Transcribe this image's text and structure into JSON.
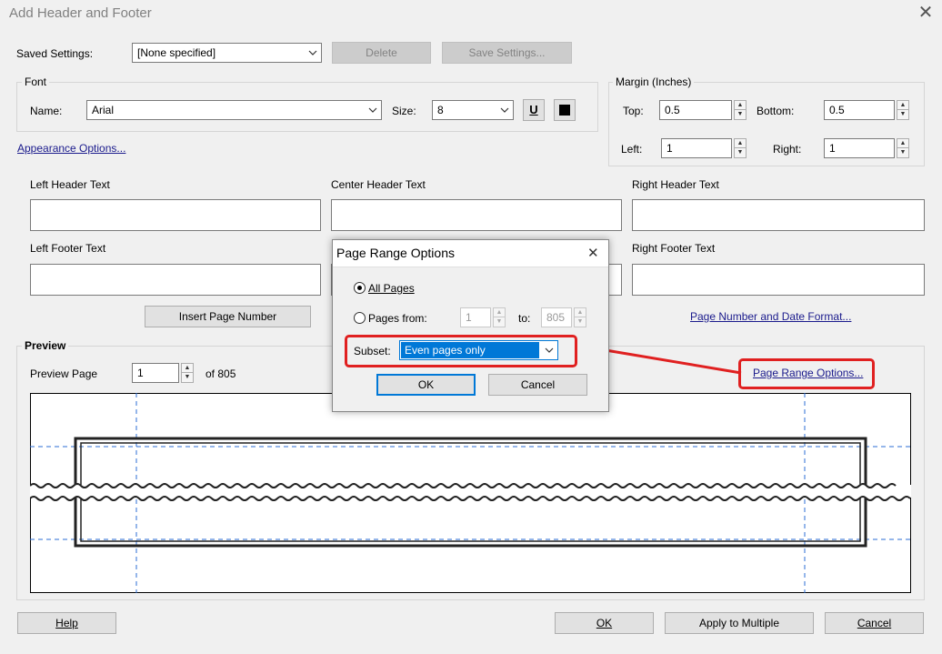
{
  "window": {
    "title": "Add Header and Footer",
    "close_glyph": "✕"
  },
  "saved_settings": {
    "label": "Saved Settings:",
    "value": "[None specified]",
    "delete_label": "Delete",
    "save_label": "Save Settings..."
  },
  "font": {
    "group_label": "Font",
    "name_label": "Name:",
    "name_value": "Arial",
    "size_label": "Size:",
    "size_value": "8",
    "underline_label": "U"
  },
  "margin": {
    "group_label": "Margin (Inches)",
    "top_label": "Top:",
    "top_value": "0.5",
    "bottom_label": "Bottom:",
    "bottom_value": "0.5",
    "left_label": "Left:",
    "left_value": "1",
    "right_label": "Right:",
    "right_value": "1"
  },
  "appearance_link": "Appearance Options...",
  "fields": {
    "left_header": "Left Header Text",
    "center_header": "Center Header Text",
    "right_header": "Right Header Text",
    "left_footer": "Left Footer Text",
    "right_footer": "Right Footer Text"
  },
  "insert_page_number": "Insert Page Number",
  "page_number_date_link": "Page Number and Date Format...",
  "preview": {
    "label": "Preview",
    "page_label": "Preview Page",
    "page_value": "1",
    "of_total": "of 805",
    "page_range_link": "Page Range Options..."
  },
  "footer_buttons": {
    "help": "Help",
    "ok": "OK",
    "apply_multiple": "Apply to Multiple",
    "cancel": "Cancel"
  },
  "dialog": {
    "title": "Page Range Options",
    "close_glyph": "✕",
    "all_pages": "All Pages",
    "pages_from": "Pages from:",
    "from_value": "1",
    "to_label": "to:",
    "to_value": "805",
    "subset_label": "Subset:",
    "subset_value": "Even pages only",
    "ok": "OK",
    "cancel": "Cancel"
  },
  "colors": {
    "annotation_red": "#e02020",
    "link_blue": "#1a1a8c",
    "selection_blue": "#0078d7",
    "guide_blue": "#2b6cd6"
  }
}
